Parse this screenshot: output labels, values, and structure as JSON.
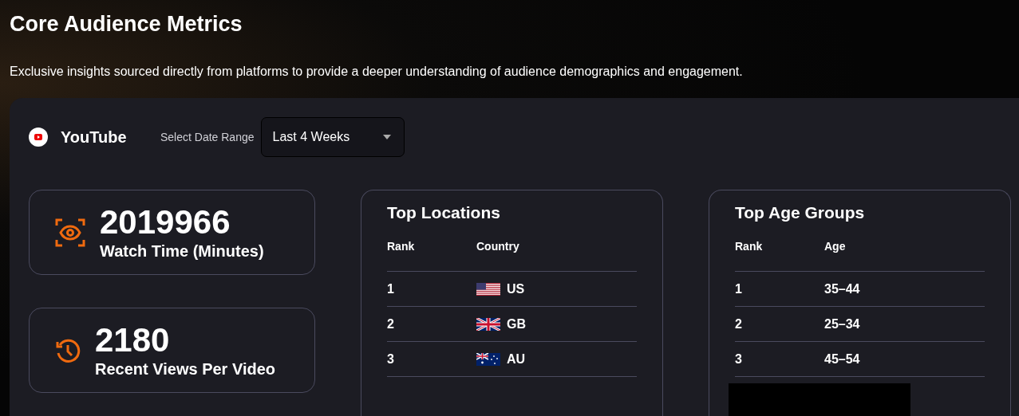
{
  "title": "Core Audience Metrics",
  "description": "Exclusive insights sourced directly from platforms to provide a deeper understanding of audience demographics and engagement.",
  "platform": {
    "name": "YouTube"
  },
  "date_range": {
    "label": "Select Date Range",
    "value": "Last 4 Weeks"
  },
  "metrics": [
    {
      "kind": "watch",
      "value": "2019966",
      "label": "Watch Time (Minutes)"
    },
    {
      "kind": "history",
      "value": "2180",
      "label": "Recent Views Per Video"
    }
  ],
  "tables": [
    {
      "title": "Top Locations",
      "columns": [
        "Rank",
        "Country"
      ],
      "rows": [
        {
          "rank": "1",
          "value": "US",
          "kind": "us"
        },
        {
          "rank": "2",
          "value": "GB",
          "kind": "gb"
        },
        {
          "rank": "3",
          "value": "AU",
          "kind": "au"
        }
      ]
    },
    {
      "title": "Top Age Groups",
      "columns": [
        "Rank",
        "Age"
      ],
      "rows": [
        {
          "rank": "1",
          "value": "35–44"
        },
        {
          "rank": "2",
          "value": "25–34"
        },
        {
          "rank": "3",
          "value": "45–54"
        }
      ],
      "redacted": true
    }
  ]
}
